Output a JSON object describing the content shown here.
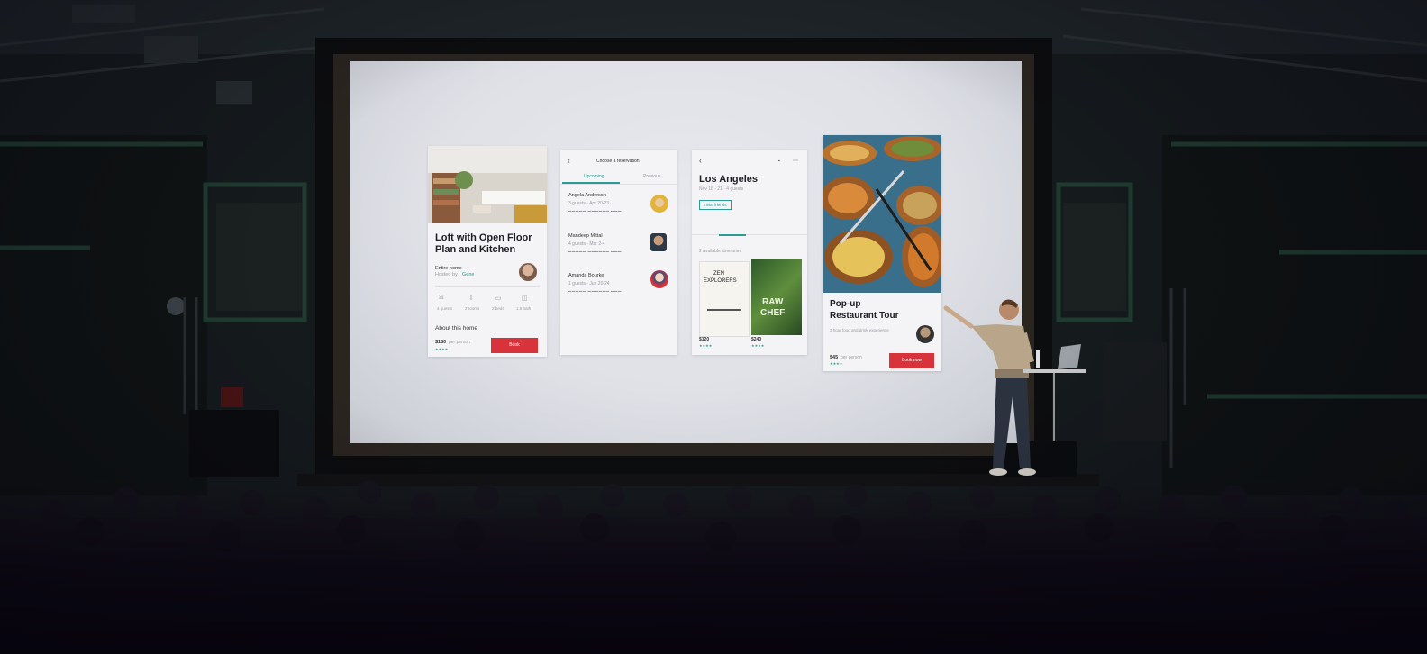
{
  "screen": {
    "card_home": {
      "title_line1": "Loft with Open Floor",
      "title_line2": "Plan and Kitchen",
      "type": "Entire home",
      "hosted": "Hosted by",
      "host": "Gene",
      "amenities": [
        "4 guests",
        "2 rooms",
        "2 beds",
        "1.5 bath"
      ],
      "about": "About this home",
      "price": "$180",
      "price_unit": "per person",
      "button": "Book"
    },
    "card_reservations": {
      "header": "Choose a reservation",
      "tabs": [
        "Upcoming",
        "Previous"
      ],
      "items": [
        {
          "name": "Angela Anderson",
          "detail": "3 guests · Apr 20-23"
        },
        {
          "name": "Mandeep Mittal",
          "detail": "4 guests · Mar 2-4"
        },
        {
          "name": "Amanda Bourke",
          "detail": "1 guests · Jun 20-24"
        }
      ]
    },
    "card_city": {
      "city": "Los Angeles",
      "dates": "Nov 18 - 21 · 4 guests",
      "invite": "Invite friends",
      "count": "2 available itineraries",
      "book1_title_line1": "ZEN",
      "book1_title_line2": "EXPLORERS",
      "book2_title_line1": "RAW",
      "book2_title_line2": "CHEF",
      "book1_price": "$120",
      "book2_price": "$240"
    },
    "card_food": {
      "title_line1": "Pop-up",
      "title_line2": "Restaurant Tour",
      "desc": "3 hour food and drink experience",
      "price": "$45",
      "price_unit": "per person",
      "button": "Book now"
    }
  },
  "colors": {
    "accent_red": "#d8333b",
    "accent_teal": "#2b9c94",
    "screen": "#e3e5ea"
  }
}
